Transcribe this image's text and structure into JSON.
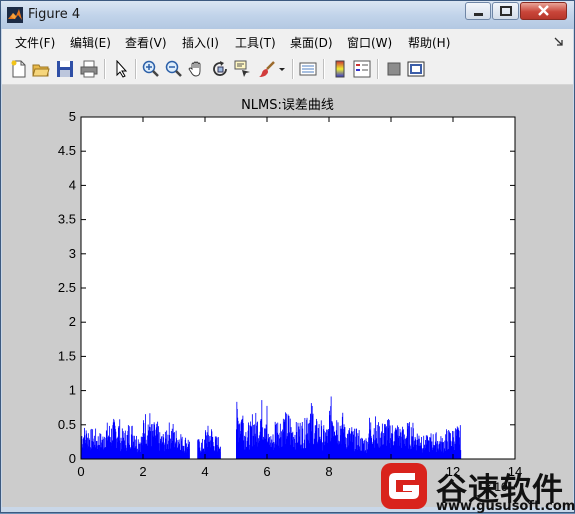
{
  "window": {
    "title": "Figure 4"
  },
  "menu": {
    "items": [
      "文件(F)",
      "编辑(E)",
      "查看(V)",
      "插入(I)",
      "工具(T)",
      "桌面(D)",
      "窗口(W)",
      "帮助(H)"
    ]
  },
  "toolbar": {
    "buttons": [
      "new-figure-icon",
      "open-file-icon",
      "save-icon",
      "print-icon",
      "select-arrow-icon",
      "zoom-in-icon",
      "zoom-out-icon",
      "pan-hand-icon",
      "rotate-3d-icon",
      "data-cursor-icon",
      "brush-icon",
      "dropdown-arrow-icon",
      "link-plot-icon",
      "colorbar-icon",
      "legend-icon",
      "hide-plot-tools-icon",
      "show-plot-tools-icon"
    ]
  },
  "chart_data": {
    "type": "bar",
    "title": "NLMS:误差曲线",
    "xlabel": "",
    "ylabel": "",
    "xlim": [
      0,
      14
    ],
    "ylim": [
      0,
      5
    ],
    "x_ticks": [
      "0",
      "2",
      "4",
      "6",
      "8",
      "10",
      "12",
      "14"
    ],
    "y_ticks": [
      "0",
      "0.5",
      "1",
      "1.5",
      "2",
      "2.5",
      "3",
      "3.5",
      "4",
      "4.5",
      "5"
    ],
    "x_exponent_label": "x 10",
    "color": "#0000ff",
    "series": [
      {
        "x": [
          0,
          0.25,
          0.5,
          0.75,
          1.0,
          1.25,
          1.5,
          1.75,
          2.0,
          2.25,
          2.5,
          2.75,
          3.0,
          3.25,
          3.5,
          3.75,
          4.0,
          4.25,
          4.5,
          4.75,
          5.0,
          5.25,
          5.5,
          5.75,
          6.0,
          6.25,
          6.5,
          6.75,
          7.0,
          7.25,
          7.5,
          7.75,
          8.0,
          8.25,
          8.5,
          8.75,
          9.0,
          9.25,
          9.5,
          9.75,
          10.0,
          10.25,
          10.5,
          10.75,
          11.0,
          11.25,
          11.5,
          11.75,
          12.0,
          12.25
        ],
        "values": [
          0.5,
          0.45,
          0.4,
          0.55,
          0.6,
          0.45,
          0.55,
          0.4,
          0.72,
          0.55,
          0.4,
          0.55,
          0.45,
          0.35,
          0.0,
          0.3,
          0.5,
          0.35,
          0.0,
          0.0,
          0.85,
          0.55,
          0.7,
          0.9,
          0.4,
          0.65,
          0.7,
          0.55,
          0.6,
          0.85,
          0.6,
          0.5,
          0.92,
          0.7,
          0.5,
          0.45,
          0.35,
          0.65,
          0.55,
          0.6,
          0.55,
          0.5,
          0.55,
          0.45,
          0.35,
          0.4,
          0.35,
          0.45,
          0.5,
          0.0
        ]
      }
    ]
  },
  "watermark": {
    "name": "谷速软件",
    "url": "www.gususoft.com"
  }
}
